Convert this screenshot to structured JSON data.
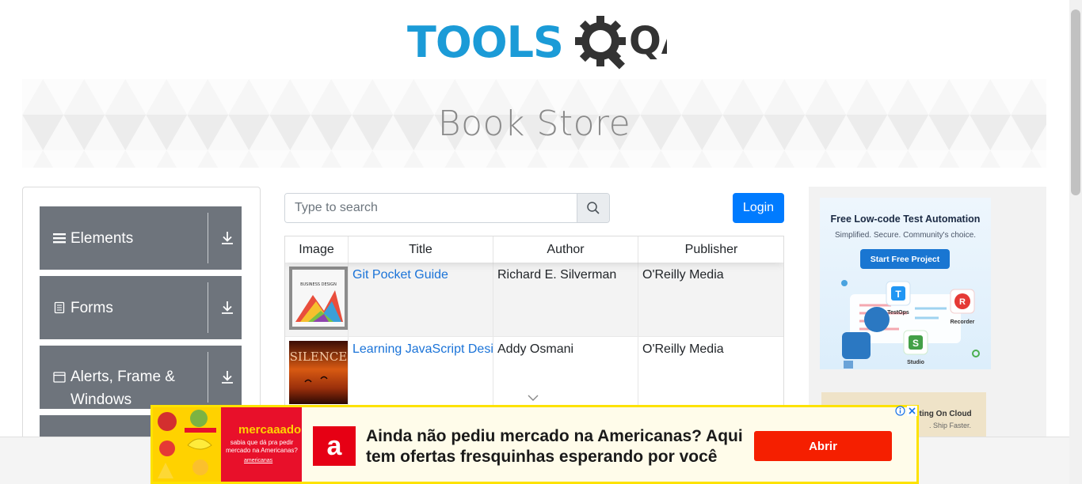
{
  "header": {
    "logo_text": "TOOLS",
    "logo_suffix": "QA"
  },
  "banner": {
    "title": "Book Store"
  },
  "sidebar": {
    "groups": [
      {
        "label": "Elements",
        "icon": "hamburger-icon"
      },
      {
        "label": "Forms",
        "icon": "document-icon"
      },
      {
        "label": "Alerts, Frame & Windows",
        "icon": "window-icon"
      }
    ]
  },
  "search": {
    "placeholder": "Type to search",
    "value": ""
  },
  "login": {
    "label": "Login"
  },
  "table": {
    "headers": [
      "Image",
      "Title",
      "Author",
      "Publisher"
    ],
    "rows": [
      {
        "title": "Git Pocket Guide",
        "author": "Richard E. Silverman",
        "publisher": "O'Reilly Media"
      },
      {
        "title": "Learning JavaScript Design Patterns",
        "author": "Addy Osmani",
        "publisher": "O'Reilly Media"
      }
    ]
  },
  "thumbs": {
    "book1_cover_text": "BUSINESS DESIGN",
    "book2_cover_text": "SILENCE"
  },
  "right_ad": {
    "heading": "Free Low-code Test Automation",
    "sub": "Simplified. Secure. Community's choice.",
    "button": "Start Free Project",
    "nodes": [
      "TestOps",
      "Recorder",
      "Studio"
    ],
    "ad2_title": "sting On Cloud",
    "ad2_sub": ". Ship Faster."
  },
  "bottom_ad": {
    "brand_title": "mercaaado",
    "brand_sub": "sabia que dá pra pedir mercado na Americanas?",
    "brand_link": "americanas",
    "logo_letter": "a",
    "message_line1": "Ainda não pediu mercado na Americanas? Aqui",
    "message_line2": "tem ofertas fresquinhas esperando por você",
    "cta": "Abrir"
  },
  "colors": {
    "brand_blue": "#1b9bd7",
    "sidebar_gray": "#6e747c",
    "login_blue": "#007bff",
    "ad_yellow": "#fde200",
    "ad_red": "#f51f00"
  }
}
